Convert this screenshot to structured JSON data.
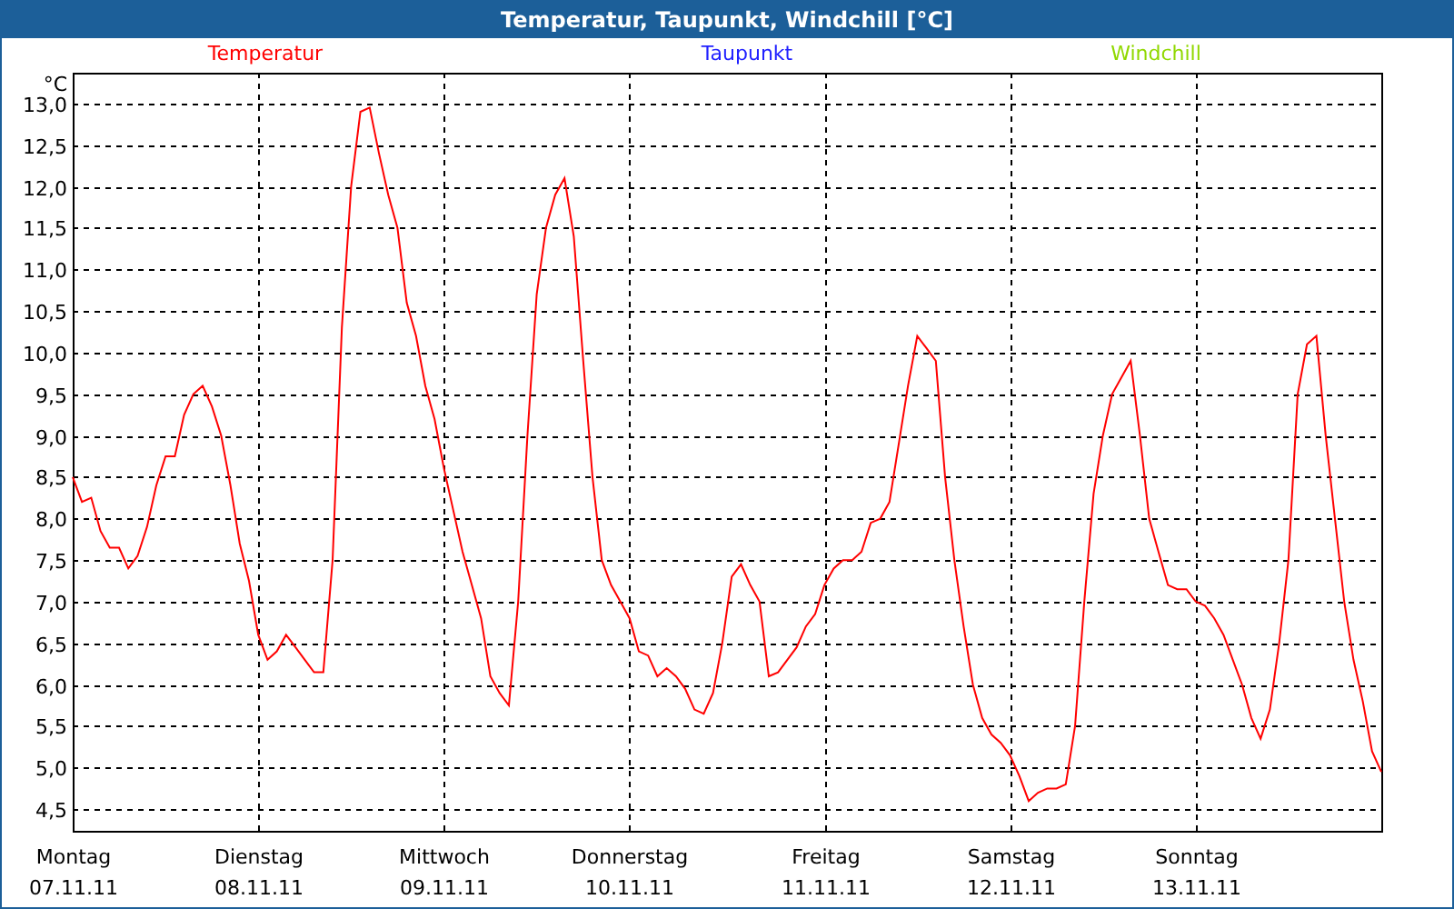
{
  "window": {
    "title": "Temperatur, Taupunkt, Windchill [°C]"
  },
  "chart": {
    "legend": [
      {
        "label": "Temperatur",
        "color": "#ff0000"
      },
      {
        "label": "Taupunkt",
        "color": "#2020ff"
      },
      {
        "label": "Windchill",
        "color": "#90d800"
      }
    ],
    "chart_data": {
      "type": "line",
      "grid": true,
      "ylabel": "°C",
      "ylim": [
        4.24,
        13.37
      ],
      "categories": [
        "Montag\n07.11.11",
        null,
        null,
        null,
        null,
        null,
        null,
        null,
        null,
        null,
        null,
        null,
        null,
        null,
        null,
        null,
        null,
        null,
        null,
        null,
        "Dienstag\n08.11.11",
        null,
        null,
        null,
        null,
        null,
        null,
        null,
        null,
        null,
        null,
        null,
        null,
        null,
        null,
        null,
        null,
        null,
        null,
        null,
        "Mittwoch\n09.11.11",
        null,
        null,
        null,
        null,
        null,
        null,
        null,
        null,
        null,
        null,
        null,
        null,
        null,
        null,
        null,
        null,
        null,
        null,
        null,
        "Donnerstag\n10.11.11",
        null,
        null,
        null,
        null,
        null,
        null,
        null,
        null,
        null,
        null,
        null,
        null,
        null,
        null,
        null,
        null,
        null,
        null,
        null,
        null,
        "Freitag\n11.11.11",
        null,
        null,
        null,
        null,
        null,
        null,
        null,
        null,
        null,
        null,
        null,
        null,
        null,
        null,
        null,
        null,
        null,
        null,
        null,
        "Samstag\n12.11.11",
        null,
        null,
        null,
        null,
        null,
        null,
        null,
        null,
        null,
        null,
        null,
        null,
        null,
        null,
        null,
        null,
        null,
        null,
        null,
        "Sonntag\n13.11.11",
        null,
        null,
        null,
        null,
        null,
        null,
        null,
        null,
        null,
        null,
        null,
        null,
        null,
        null,
        null,
        null,
        null,
        null,
        null,
        null
      ],
      "series": [
        {
          "color": "#ff0000",
          "values": [
            8.5,
            8.2,
            8.25,
            7.85,
            7.65,
            7.65,
            7.4,
            7.55,
            7.9,
            8.4,
            8.75,
            8.75,
            9.25,
            9.5,
            9.6,
            9.35,
            9.0,
            8.4,
            7.7,
            7.25,
            6.6,
            6.3,
            6.4,
            6.6,
            6.45,
            6.3,
            6.15,
            6.15,
            7.5,
            10.3,
            12.0,
            12.9,
            12.95,
            12.4,
            11.9,
            11.5,
            10.6,
            10.2,
            9.6,
            9.2,
            8.6,
            8.1,
            7.6,
            7.2,
            6.8,
            6.1,
            5.9,
            5.75,
            7.0,
            9.0,
            10.7,
            11.5,
            11.9,
            12.1,
            11.4,
            9.9,
            8.5,
            7.5,
            7.2,
            7.0,
            6.8,
            6.4,
            6.35,
            6.1,
            6.2,
            6.1,
            5.95,
            5.7,
            5.65,
            5.9,
            6.5,
            7.3,
            7.45,
            7.2,
            7.0,
            6.1,
            6.15,
            6.3,
            6.45,
            6.7,
            6.85,
            7.2,
            7.4,
            7.5,
            7.5,
            7.6,
            7.95,
            8.0,
            8.2,
            8.9,
            9.6,
            10.2,
            10.05,
            9.9,
            8.5,
            7.5,
            6.7,
            6.0,
            5.6,
            5.4,
            5.3,
            5.15,
            4.9,
            4.6,
            4.7,
            4.75,
            4.75,
            4.8,
            5.5,
            7.0,
            8.3,
            9.0,
            9.5,
            9.7,
            9.9,
            9.0,
            8.0,
            7.6,
            7.2,
            7.15,
            7.15,
            7.0,
            6.95,
            6.8,
            6.6,
            6.3,
            6.0,
            5.6,
            5.35,
            5.7,
            6.5,
            7.5,
            9.5,
            10.1,
            10.2,
            9.0,
            8.0,
            7.0,
            6.3,
            5.8,
            5.2,
            4.95
          ]
        }
      ],
      "yticks": [
        {
          "value": 4.5,
          "label": "4,5"
        },
        {
          "value": 5,
          "label": "5,0"
        },
        {
          "value": 5.5,
          "label": "5,5"
        },
        {
          "value": 6,
          "label": "6,0"
        },
        {
          "value": 6.5,
          "label": "6,5"
        },
        {
          "value": 7,
          "label": "7,0"
        },
        {
          "value": 7.5,
          "label": "7,5"
        },
        {
          "value": 8,
          "label": "8,0"
        },
        {
          "value": 8.5,
          "label": "8,5"
        },
        {
          "value": 9,
          "label": "9,0"
        },
        {
          "value": 9.5,
          "label": "9,5"
        },
        {
          "value": 10,
          "label": "10,0"
        },
        {
          "value": 10.5,
          "label": "10,5"
        },
        {
          "value": 11,
          "label": "11,0"
        },
        {
          "value": 11.5,
          "label": "11,5"
        },
        {
          "value": 12,
          "label": "12,0"
        },
        {
          "value": 12.5,
          "label": "12,5"
        },
        {
          "value": 13,
          "label": "13,0"
        }
      ]
    }
  }
}
